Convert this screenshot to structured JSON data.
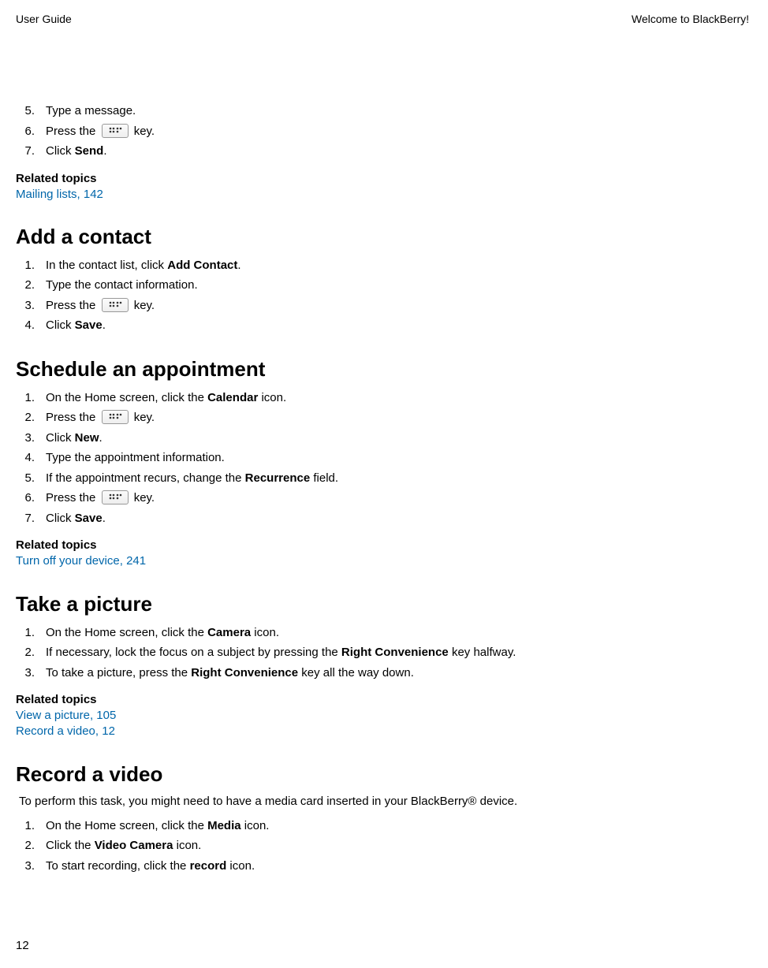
{
  "header": {
    "left": "User Guide",
    "right": "Welcome to BlackBerry!"
  },
  "topList": {
    "items": [
      {
        "num": "5.",
        "text": "Type a message."
      },
      {
        "num": "6.",
        "pre": "Press the ",
        "post": " key.",
        "hasKey": true
      },
      {
        "num": "7.",
        "pre": "Click ",
        "bold": "Send",
        "post": "."
      }
    ]
  },
  "related1": {
    "heading": "Related topics",
    "links": [
      "Mailing lists, 142"
    ]
  },
  "sectionA": {
    "title": "Add a contact",
    "items": [
      {
        "num": "1.",
        "pre": "In the contact list, click ",
        "bold": "Add Contact",
        "post": "."
      },
      {
        "num": "2.",
        "text": "Type the contact information."
      },
      {
        "num": "3.",
        "pre": "Press the ",
        "post": " key.",
        "hasKey": true
      },
      {
        "num": "4.",
        "pre": "Click ",
        "bold": "Save",
        "post": "."
      }
    ]
  },
  "sectionB": {
    "title": "Schedule an appointment",
    "items": [
      {
        "num": "1.",
        "pre": "On the Home screen, click the ",
        "bold": "Calendar",
        "post": " icon."
      },
      {
        "num": "2.",
        "pre": "Press the ",
        "post": " key.",
        "hasKey": true
      },
      {
        "num": "3.",
        "pre": "Click ",
        "bold": "New",
        "post": "."
      },
      {
        "num": "4.",
        "text": "Type the appointment information."
      },
      {
        "num": "5.",
        "pre": "If the appointment recurs, change the ",
        "bold": "Recurrence",
        "post": " field."
      },
      {
        "num": "6.",
        "pre": "Press the ",
        "post": " key.",
        "hasKey": true
      },
      {
        "num": "7.",
        "pre": "Click ",
        "bold": "Save",
        "post": "."
      }
    ]
  },
  "related2": {
    "heading": "Related topics",
    "links": [
      "Turn off your device, 241"
    ]
  },
  "sectionC": {
    "title": "Take a picture",
    "items": [
      {
        "num": "1.",
        "pre": "On the Home screen, click the ",
        "bold": "Camera",
        "post": " icon."
      },
      {
        "num": "2.",
        "pre": "If necessary, lock the focus on a subject by pressing the ",
        "bold": "Right Convenience",
        "post": " key halfway."
      },
      {
        "num": "3.",
        "pre": "To take a picture, press the ",
        "bold": "Right Convenience",
        "post": " key all the way down."
      }
    ]
  },
  "related3": {
    "heading": "Related topics",
    "links": [
      "View a picture, 105",
      "Record a video, 12"
    ]
  },
  "sectionD": {
    "title": "Record a video",
    "intro": "To perform this task, you might need to have a media card inserted in your BlackBerry® device.",
    "items": [
      {
        "num": "1.",
        "pre": "On the Home screen, click the ",
        "bold": "Media",
        "post": " icon."
      },
      {
        "num": "2.",
        "pre": "Click the ",
        "bold": "Video Camera",
        "post": " icon."
      },
      {
        "num": "3.",
        "pre": "To start recording, click the ",
        "bold": "record",
        "post": " icon."
      }
    ]
  },
  "pageNumber": "12"
}
